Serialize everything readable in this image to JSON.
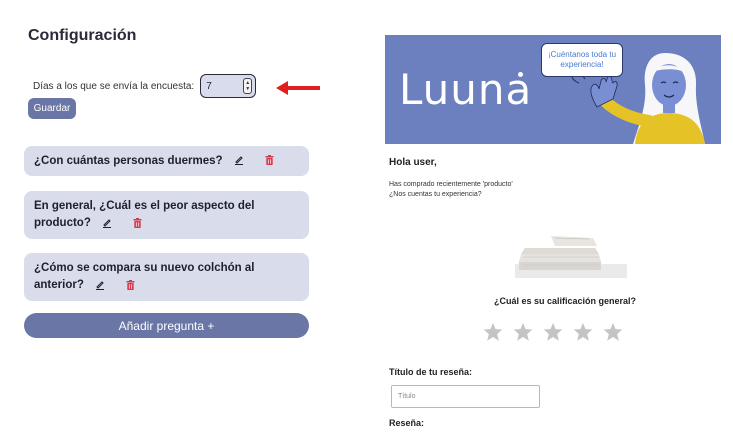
{
  "page_title": "Configuración",
  "survey_days": {
    "label": "Días a los que se envía la encuesta:",
    "value": "7"
  },
  "save_label": "Guardar",
  "questions": [
    {
      "text": "¿Con cuántas personas duermes?"
    },
    {
      "text": "En general, ¿Cuál es el peor aspecto del producto?"
    },
    {
      "text": "¿Cómo se compara su nuevo colchón al anterior?"
    }
  ],
  "add_question_label": "Añadir pregunta +",
  "preview": {
    "brand": "Luuna",
    "bubble_text": "¡Cuéntanos toda tu experiencia!",
    "greeting": "Hola user,",
    "message_line1": "Has comprado recientemente 'producto'",
    "message_line2": "¿Nos cuentas tu experiencia?",
    "rating_question": "¿Cuál es su calificación general?",
    "rating": 0,
    "rating_max": 5,
    "review_title_label": "Título de tu reseña:",
    "review_title_placeholder": "Título",
    "review_label": "Reseña:"
  },
  "colors": {
    "accent": "#6a76a5",
    "card_bg": "#d9dceb",
    "banner_bg": "#6c7fbf",
    "delete": "#d63a4a",
    "arrow": "#e02020",
    "star_empty": "#c4c4c4"
  }
}
